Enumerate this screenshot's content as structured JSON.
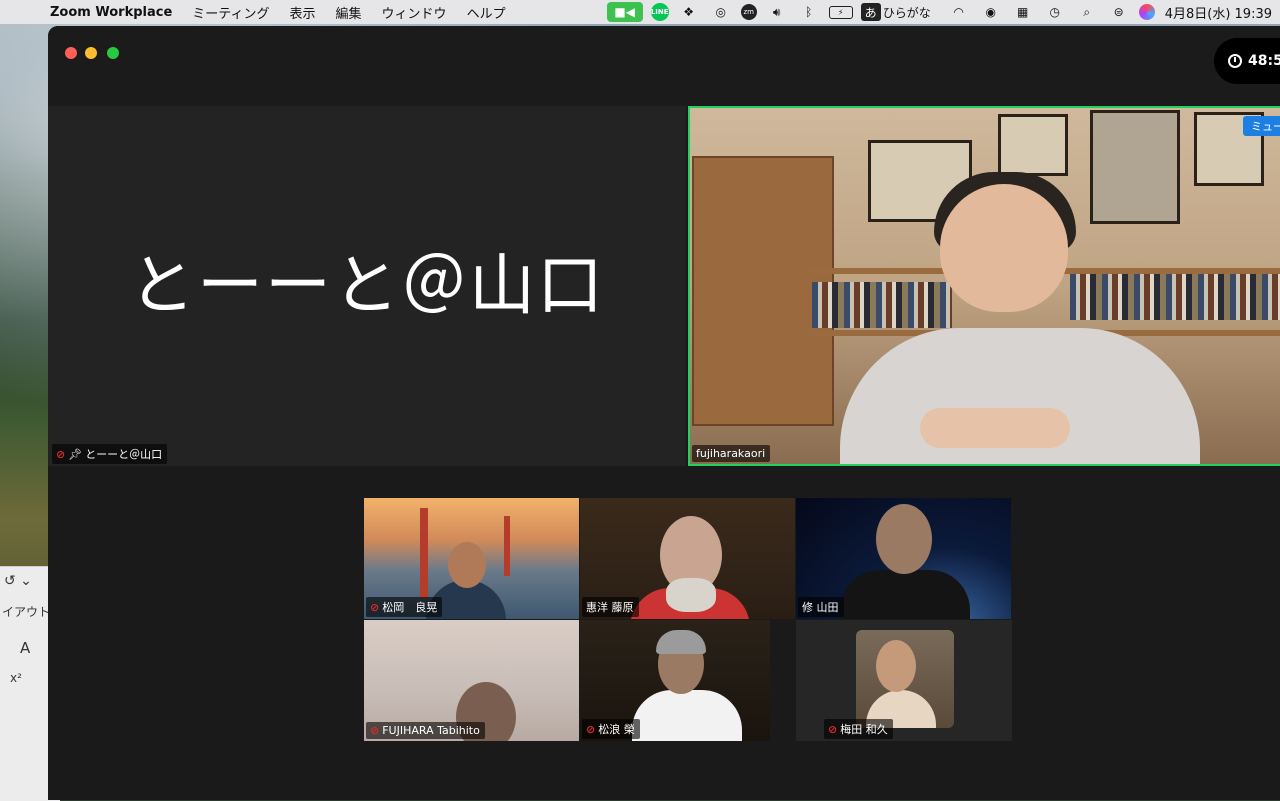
{
  "menubar": {
    "app_name": "Zoom Workplace",
    "menus": [
      "ミーティング",
      "表示",
      "編集",
      "ウィンドウ",
      "ヘルプ"
    ],
    "line_label": "LINE",
    "zm_label": "zm",
    "ime_box": "あ",
    "ime_label": "ひらがな",
    "datetime": "4月8日(水)  19:39"
  },
  "meeting": {
    "timer": "48:5",
    "name_tile": {
      "display_name": "とーーと＠山口",
      "label": "とーーと＠山口"
    },
    "active_speaker": {
      "label": "fujiharakaori",
      "badge": "ミュー"
    },
    "gallery": [
      {
        "label": "松岡　良晃",
        "muted": true
      },
      {
        "label": "惠洋 藤原",
        "muted": false
      },
      {
        "label": "修 山田",
        "muted": false
      },
      {
        "label": "FUJIHARA Tabihito",
        "muted": true
      },
      {
        "label": "松浪 榮",
        "muted": true
      },
      {
        "label": "梅田 和久",
        "muted": true
      }
    ]
  },
  "bg_app": {
    "layout_label": "イアウト",
    "font_label": "A",
    "superscript_label": "x²"
  },
  "colors": {
    "speaker_border": "#23d160",
    "mute_badge": "#1e7fe3",
    "mic_off": "#e02828"
  }
}
